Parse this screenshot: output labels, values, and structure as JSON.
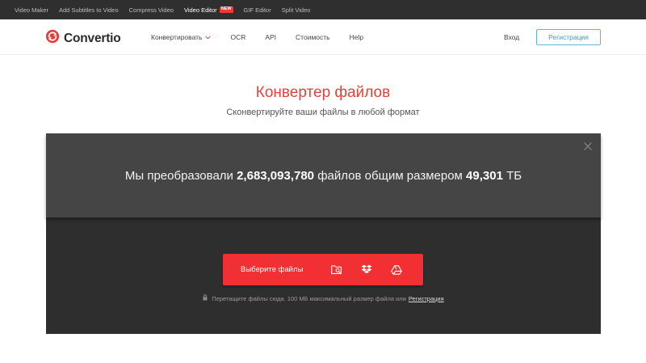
{
  "topbar": {
    "links": [
      {
        "label": "Video Maker",
        "active": false,
        "badge": ""
      },
      {
        "label": "Add Subtitles to Video",
        "active": false,
        "badge": ""
      },
      {
        "label": "Compress Video",
        "active": false,
        "badge": ""
      },
      {
        "label": "Video Editor",
        "active": true,
        "badge": "NEW"
      },
      {
        "label": "GIF Editor",
        "active": false,
        "badge": ""
      },
      {
        "label": "Split Video",
        "active": false,
        "badge": ""
      }
    ]
  },
  "header": {
    "logo_text": "Convertio",
    "nav": [
      {
        "label": "Конвертировать",
        "dropdown": true
      },
      {
        "label": "OCR",
        "dropdown": false
      },
      {
        "label": "API",
        "dropdown": false
      },
      {
        "label": "Стоимость",
        "dropdown": false
      },
      {
        "label": "Help",
        "dropdown": false
      }
    ],
    "login_label": "Вход",
    "register_label": "Регистрация"
  },
  "hero": {
    "title": "Конвертер файлов",
    "subtitle": "Сконвертируйте ваши файлы в любой формат"
  },
  "stats": {
    "prefix": "Мы преобразовали",
    "files_count": "2,683,093,780",
    "middle": "файлов общим размером",
    "total_size": "49,301",
    "unit": "ТБ"
  },
  "upload": {
    "button_label": "Выберите файлы",
    "icons": [
      "folder-search-icon",
      "dropbox-icon",
      "google-drive-icon"
    ],
    "hint": "Перетащите файлы сюда. 100 МБ максимальный размер файла или",
    "hint_link": "Регистрация"
  },
  "colors": {
    "accent": "#f22f32",
    "title": "#e2433b",
    "topbar_bg": "#2f2f2f",
    "panel_bg": "#2e2e2e",
    "stats_bg": "#454545",
    "register_border": "#5bb6d9"
  }
}
